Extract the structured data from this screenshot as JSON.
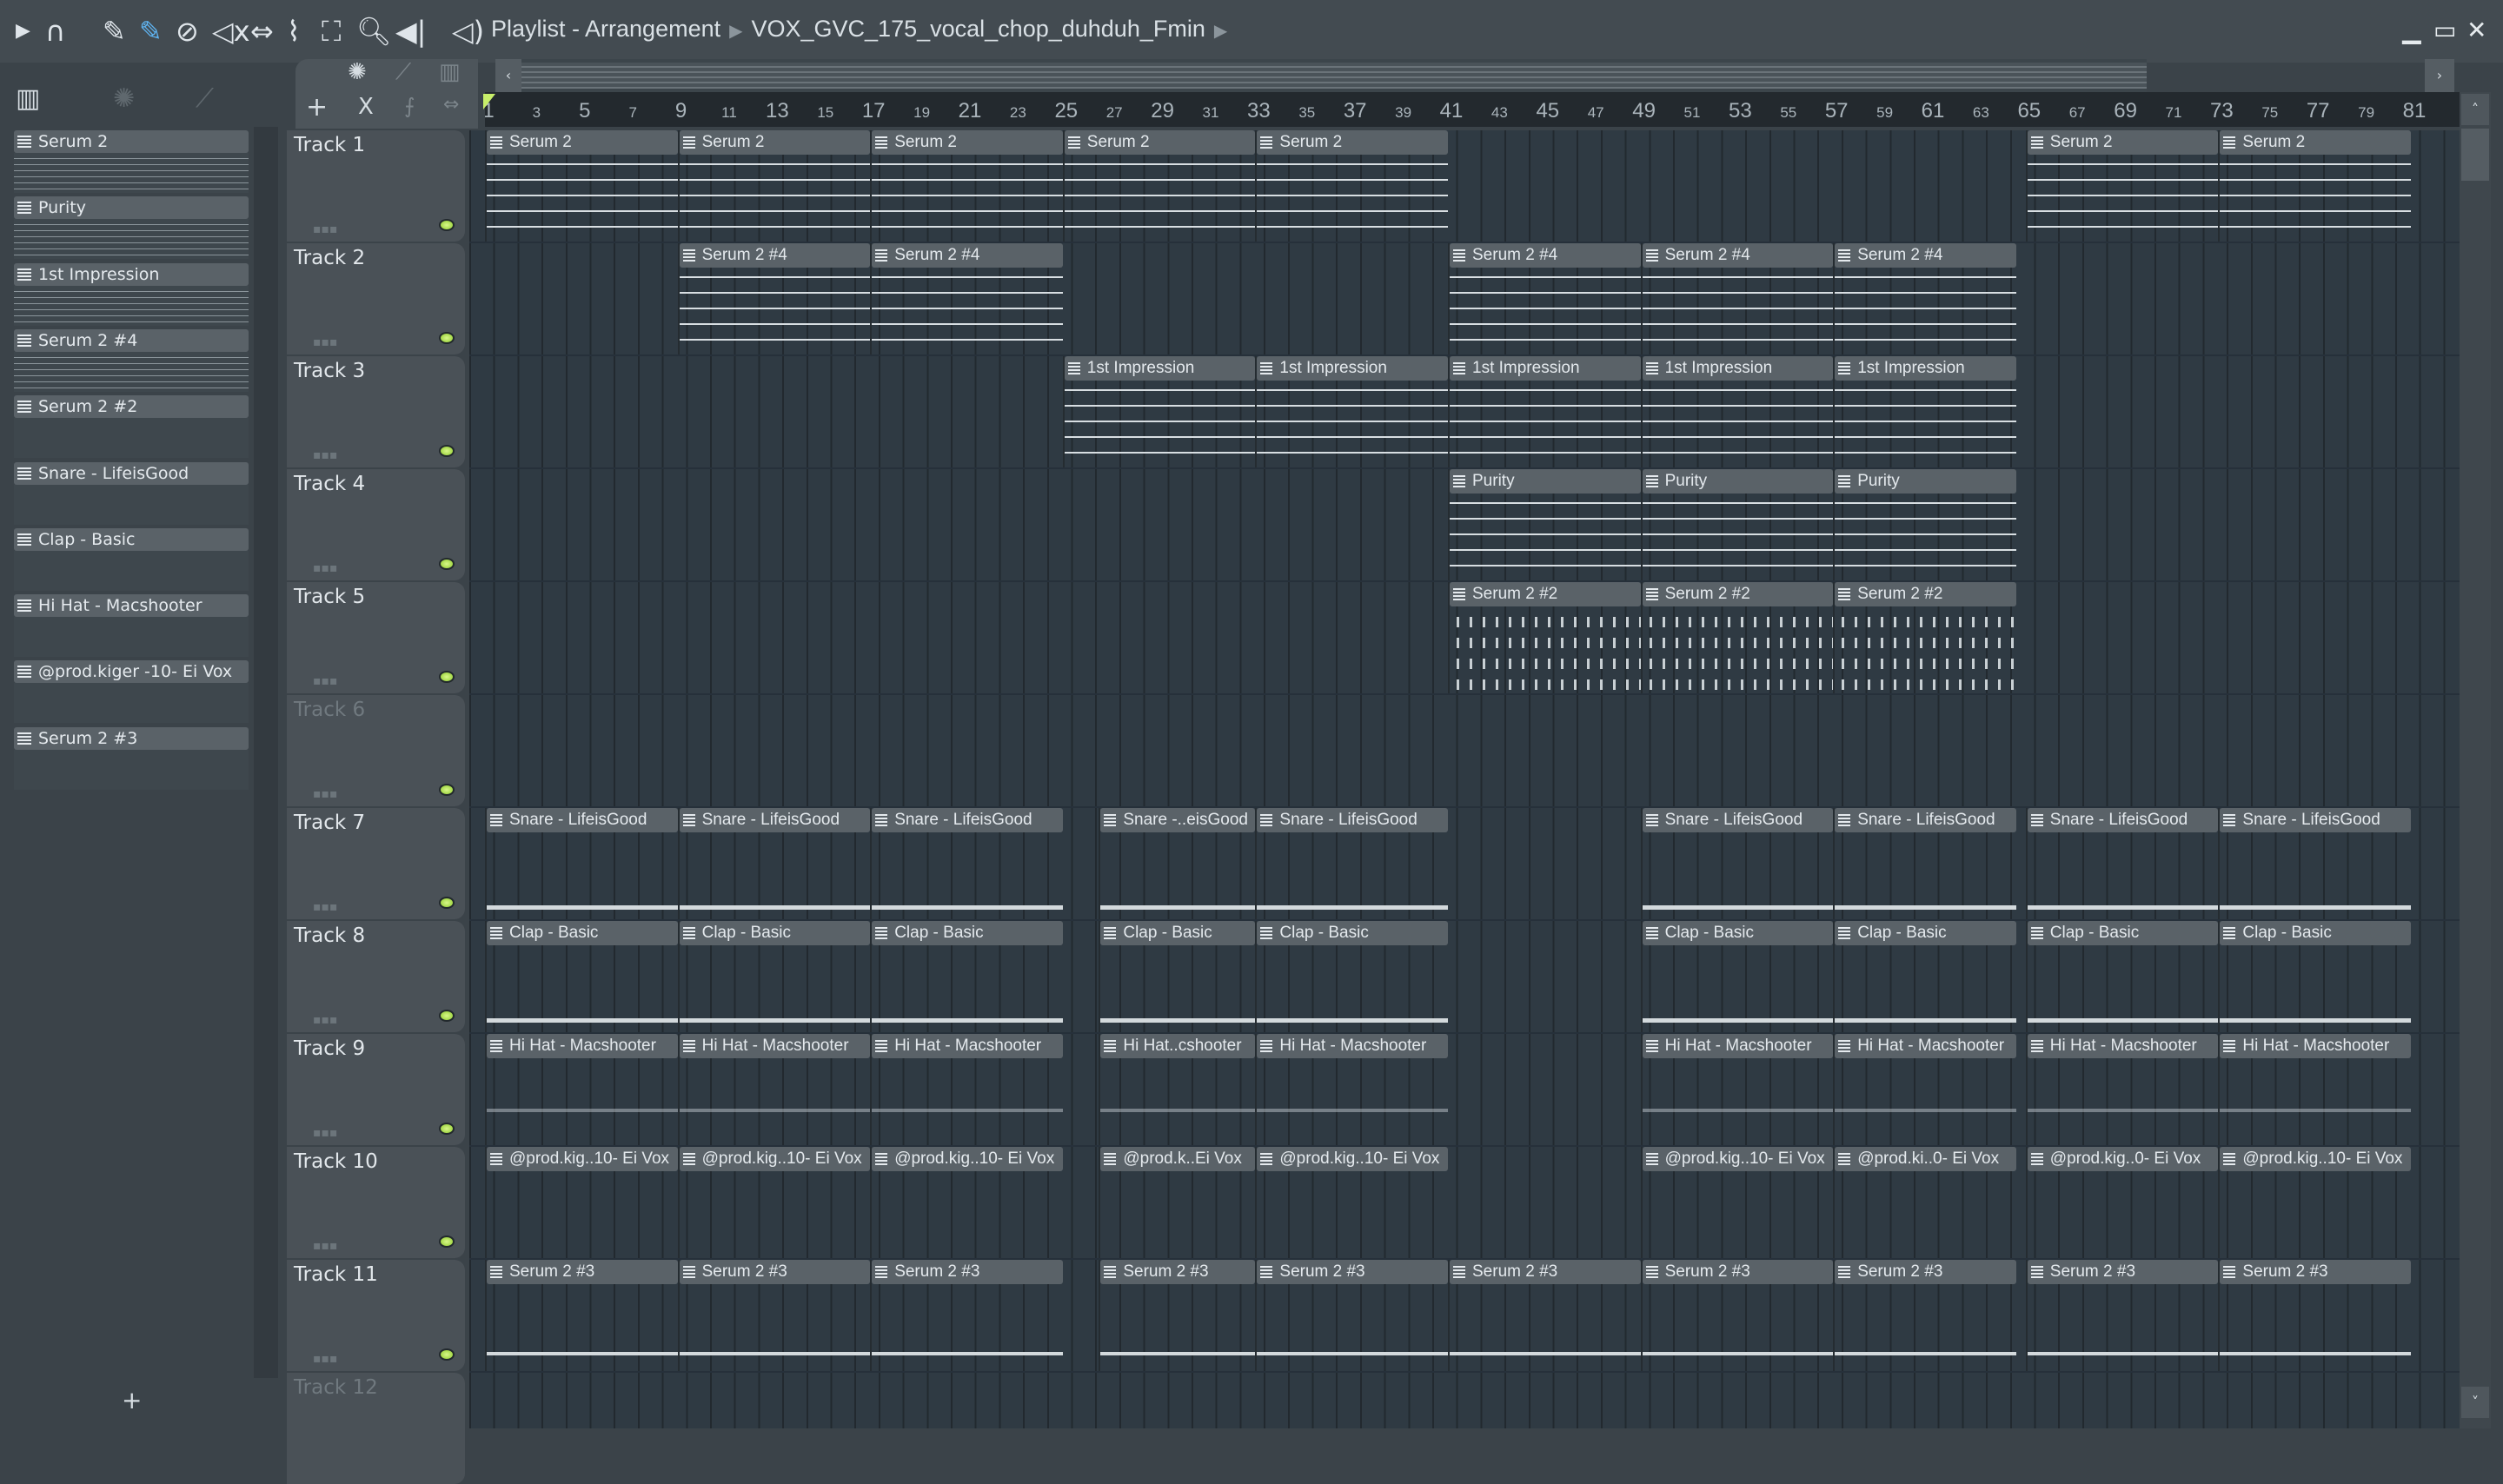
{
  "window": {
    "title": "Playlist - Arrangement",
    "pattern": "VOX_GVC_175_vocal_chop_duhduh_Fmin"
  },
  "toolbar": [
    "play-arrow-icon",
    "magnet-icon",
    "pencil-icon",
    "paint-icon",
    "delete-icon",
    "mute-icon",
    "slip-icon",
    "slice-icon",
    "select-icon",
    "zoom-icon",
    "playback-icon"
  ],
  "colors": {
    "accent": "#5fb3f0",
    "led": "#9fd83a",
    "clip": "#5a6268",
    "lane": "#2f3a43"
  },
  "picker": [
    "Serum 2",
    "Purity",
    "1st Impression",
    "Serum 2 #4",
    "Serum 2 #2",
    "Snare - LifeisGood",
    "Clap - Basic",
    "Hi Hat - Macshooter",
    "@prod.kiger -10- Ei Vox",
    "Serum 2 #3"
  ],
  "picker_add": "+",
  "tools": {
    "add": "+",
    "x": "X"
  },
  "ruler": [
    1,
    3,
    5,
    7,
    9,
    11,
    13,
    15,
    17,
    19,
    21,
    23,
    25,
    27,
    29,
    31,
    33,
    35,
    37,
    39,
    41,
    43,
    45,
    47,
    49,
    51,
    53,
    55,
    57,
    59,
    61,
    63,
    65,
    67,
    69,
    71,
    73,
    75,
    77,
    79,
    81
  ],
  "tracks": [
    {
      "name": "Track 1",
      "clips": [
        {
          "l": "Serum 2",
          "s": 1,
          "n": 8,
          "k": "melody"
        },
        {
          "l": "Serum 2",
          "s": 9,
          "n": 8,
          "k": "melody"
        },
        {
          "l": "Serum 2",
          "s": 17,
          "n": 8,
          "k": "melody"
        },
        {
          "l": "Serum 2",
          "s": 25,
          "n": 8,
          "k": "melody"
        },
        {
          "l": "Serum 2",
          "s": 33,
          "n": 8,
          "k": "melody"
        },
        {
          "l": "Serum 2",
          "s": 65,
          "n": 8,
          "k": "melody"
        },
        {
          "l": "Serum 2",
          "s": 73,
          "n": 8,
          "k": "melody"
        }
      ]
    },
    {
      "name": "Track 2",
      "clips": [
        {
          "l": "Serum 2 #4",
          "s": 9,
          "n": 8,
          "k": "melody"
        },
        {
          "l": "Serum 2 #4",
          "s": 17,
          "n": 8,
          "k": "melody"
        },
        {
          "l": "Serum 2 #4",
          "s": 41,
          "n": 8,
          "k": "melody"
        },
        {
          "l": "Serum 2 #4",
          "s": 49,
          "n": 8,
          "k": "melody"
        },
        {
          "l": "Serum 2 #4",
          "s": 57,
          "n": 7.6,
          "k": "melody"
        }
      ]
    },
    {
      "name": "Track 3",
      "clips": [
        {
          "l": "1st Impression",
          "s": 25,
          "n": 8,
          "k": "melody"
        },
        {
          "l": "1st Impression",
          "s": 33,
          "n": 8,
          "k": "melody"
        },
        {
          "l": "1st Impression",
          "s": 41,
          "n": 8,
          "k": "melody"
        },
        {
          "l": "1st Impression",
          "s": 49,
          "n": 8,
          "k": "melody"
        },
        {
          "l": "1st Impression",
          "s": 57,
          "n": 7.6,
          "k": "melody"
        }
      ]
    },
    {
      "name": "Track 4",
      "clips": [
        {
          "l": "Purity",
          "s": 41,
          "n": 8,
          "k": "melody"
        },
        {
          "l": "Purity",
          "s": 49,
          "n": 8,
          "k": "melody"
        },
        {
          "l": "Purity",
          "s": 57,
          "n": 7.6,
          "k": "melody"
        }
      ]
    },
    {
      "name": "Track 5",
      "clips": [
        {
          "l": "Serum 2 #2",
          "s": 41,
          "n": 8,
          "k": "dots"
        },
        {
          "l": "Serum 2 #2",
          "s": 49,
          "n": 8,
          "k": "dots"
        },
        {
          "l": "Serum 2 #2",
          "s": 57,
          "n": 7.6,
          "k": "dots"
        }
      ]
    },
    {
      "name": "Track 6",
      "dim": true,
      "clips": []
    },
    {
      "name": "Track 7",
      "clips": [
        {
          "l": "Snare - LifeisGood",
          "s": 1,
          "n": 8,
          "k": "bottom"
        },
        {
          "l": "Snare - LifeisGood",
          "s": 9,
          "n": 8,
          "k": "bottom"
        },
        {
          "l": "Snare - LifeisGood",
          "s": 17,
          "n": 8,
          "k": "bottom"
        },
        {
          "l": "Snare -..eisGood",
          "s": 26.5,
          "n": 6.5,
          "k": "bottom"
        },
        {
          "l": "Snare - LifeisGood",
          "s": 33,
          "n": 8,
          "k": "bottom"
        },
        {
          "l": "Snare - LifeisGood",
          "s": 49,
          "n": 8,
          "k": "bottom"
        },
        {
          "l": "Snare - LifeisGood",
          "s": 57,
          "n": 7.6,
          "k": "bottom"
        },
        {
          "l": "Snare - LifeisGood",
          "s": 65,
          "n": 8,
          "k": "bottom"
        },
        {
          "l": "Snare - LifeisGood",
          "s": 73,
          "n": 8,
          "k": "bottom"
        }
      ]
    },
    {
      "name": "Track 8",
      "clips": [
        {
          "l": "Clap - Basic",
          "s": 1,
          "n": 8,
          "k": "bottom"
        },
        {
          "l": "Clap - Basic",
          "s": 9,
          "n": 8,
          "k": "bottom"
        },
        {
          "l": "Clap - Basic",
          "s": 17,
          "n": 8,
          "k": "bottom"
        },
        {
          "l": "Clap - Basic",
          "s": 26.5,
          "n": 6.5,
          "k": "bottom"
        },
        {
          "l": "Clap - Basic",
          "s": 33,
          "n": 8,
          "k": "bottom"
        },
        {
          "l": "Clap - Basic",
          "s": 49,
          "n": 8,
          "k": "bottom"
        },
        {
          "l": "Clap - Basic",
          "s": 57,
          "n": 7.6,
          "k": "bottom"
        },
        {
          "l": "Clap - Basic",
          "s": 65,
          "n": 8,
          "k": "bottom"
        },
        {
          "l": "Clap - Basic",
          "s": 73,
          "n": 8,
          "k": "bottom"
        }
      ]
    },
    {
      "name": "Track 9",
      "clips": [
        {
          "l": "Hi Hat - Macshooter",
          "s": 1,
          "n": 8,
          "k": "hat"
        },
        {
          "l": "Hi Hat - Macshooter",
          "s": 9,
          "n": 8,
          "k": "hat"
        },
        {
          "l": "Hi Hat - Macshooter",
          "s": 17,
          "n": 8,
          "k": "hat"
        },
        {
          "l": "Hi Hat..cshooter",
          "s": 26.5,
          "n": 6.5,
          "k": "hat"
        },
        {
          "l": "Hi Hat - Macshooter",
          "s": 33,
          "n": 8,
          "k": "hat"
        },
        {
          "l": "Hi Hat - Macshooter",
          "s": 49,
          "n": 8,
          "k": "hat"
        },
        {
          "l": "Hi Hat - Macshooter",
          "s": 57,
          "n": 7.6,
          "k": "hat"
        },
        {
          "l": "Hi Hat - Macshooter",
          "s": 65,
          "n": 8,
          "k": "hat"
        },
        {
          "l": "Hi Hat - Macshooter",
          "s": 73,
          "n": 8,
          "k": "hat"
        }
      ]
    },
    {
      "name": "Track 10",
      "clips": [
        {
          "l": "@prod.kig..10- Ei Vox",
          "s": 1,
          "n": 8,
          "k": "none"
        },
        {
          "l": "@prod.kig..10- Ei Vox",
          "s": 9,
          "n": 8,
          "k": "none"
        },
        {
          "l": "@prod.kig..10- Ei Vox",
          "s": 17,
          "n": 8,
          "k": "none"
        },
        {
          "l": "@prod.k..Ei Vox",
          "s": 26.5,
          "n": 6.5,
          "k": "none"
        },
        {
          "l": "@prod.kig..10- Ei Vox",
          "s": 33,
          "n": 8,
          "k": "none"
        },
        {
          "l": "@prod.kig..10- Ei Vox",
          "s": 49,
          "n": 8,
          "k": "none"
        },
        {
          "l": "@prod.ki..0- Ei Vox",
          "s": 57,
          "n": 7.6,
          "k": "none"
        },
        {
          "l": "@prod.kig..0- Ei Vox",
          "s": 65,
          "n": 8,
          "k": "none"
        },
        {
          "l": "@prod.kig..10- Ei Vox",
          "s": 73,
          "n": 8,
          "k": "none"
        }
      ]
    },
    {
      "name": "Track 11",
      "clips": [
        {
          "l": "Serum 2 #3",
          "s": 1,
          "n": 8,
          "k": "bass"
        },
        {
          "l": "Serum 2 #3",
          "s": 9,
          "n": 8,
          "k": "bass"
        },
        {
          "l": "Serum 2 #3",
          "s": 17,
          "n": 8,
          "k": "bass"
        },
        {
          "l": "Serum 2 #3",
          "s": 26.5,
          "n": 6.5,
          "k": "bass"
        },
        {
          "l": "Serum 2 #3",
          "s": 33,
          "n": 8,
          "k": "bass"
        },
        {
          "l": "Serum 2 #3",
          "s": 41,
          "n": 8,
          "k": "bass"
        },
        {
          "l": "Serum 2 #3",
          "s": 49,
          "n": 8,
          "k": "bass"
        },
        {
          "l": "Serum 2 #3",
          "s": 57,
          "n": 7.6,
          "k": "bass"
        },
        {
          "l": "Serum 2 #3",
          "s": 65,
          "n": 8,
          "k": "bass"
        },
        {
          "l": "Serum 2 #3",
          "s": 73,
          "n": 8,
          "k": "bass"
        }
      ]
    },
    {
      "name": "Track 12",
      "dim": true,
      "clips": []
    }
  ]
}
